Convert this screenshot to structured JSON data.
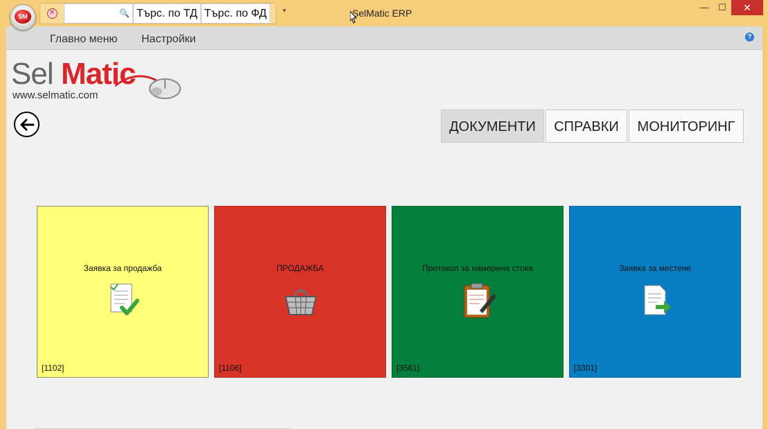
{
  "window": {
    "title": "SelMatic ERP",
    "orb_label": "SM",
    "min_symbol": "—",
    "max_symbol": "☐",
    "close_symbol": "✕"
  },
  "quick_access": {
    "search_value": "",
    "btn_search_td": "Търс. по ТД",
    "btn_search_fd": "Търс. по ФД",
    "dropdown_symbol": "▾"
  },
  "menu": {
    "main": "Главно меню",
    "settings": "Настройки",
    "help_symbol": "?"
  },
  "logo": {
    "part1": "Sel",
    "part2": "Matic",
    "url": "www.selmatic.com"
  },
  "tabs": [
    {
      "label": "ДОКУМЕНТИ",
      "active": true
    },
    {
      "label": "СПРАВКИ",
      "active": false
    },
    {
      "label": "МОНИТОРИНГ",
      "active": false
    }
  ],
  "tiles": [
    {
      "label": "Заявка за продажба",
      "code": "[1102]",
      "color": "#ffff7a",
      "icon": "document-check-icon"
    },
    {
      "label": "ПРОДАЖБА",
      "code": "[1106]",
      "color": "#d8342a",
      "icon": "shopping-basket-icon"
    },
    {
      "label": "Протокол за намерена стока",
      "code": "[3561]",
      "color": "#05803c",
      "icon": "clipboard-pen-icon"
    },
    {
      "label": "Заявка за местене",
      "code": "[3301]",
      "color": "#0a7ec4",
      "icon": "document-arrow-icon"
    }
  ]
}
